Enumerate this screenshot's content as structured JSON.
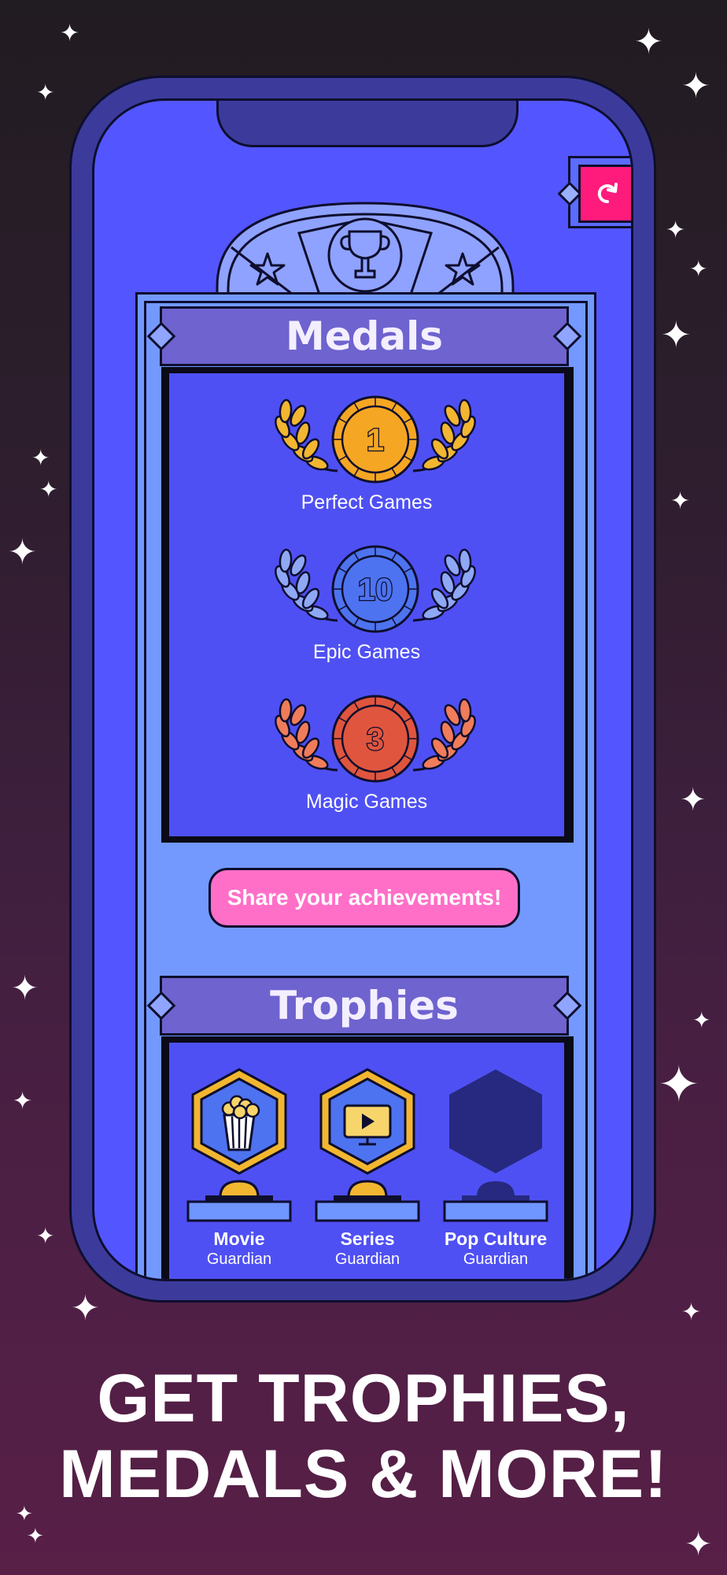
{
  "colors": {
    "background_top": "#211c21",
    "background_bottom": "#581f47",
    "phone_body": "#3c3b9c",
    "screen": "#5356ff",
    "frame": "#7399ff",
    "panel": "#4f50f3",
    "banner": "#6e63cf",
    "share_button": "#ff6fc8",
    "refresh_button": "#ff1b7c",
    "gold": "#f5a623",
    "blue": "#4d73f0",
    "red": "#e0553e"
  },
  "icons": {
    "refresh": "refresh-icon",
    "crest": "trophy-crest-icon",
    "stars": "star-icon"
  },
  "medals": {
    "title": "Medals",
    "items": [
      {
        "count": "1",
        "label": "Perfect Games",
        "color": "#f5a623",
        "leaf": "#f2b630"
      },
      {
        "count": "10",
        "label": "Epic Games",
        "color": "#4d73f0",
        "leaf": "#8ea8f5"
      },
      {
        "count": "3",
        "label": "Magic Games",
        "color": "#e0553e",
        "leaf": "#f07c5a"
      }
    ]
  },
  "share": {
    "label": "Share your achievements!"
  },
  "trophies": {
    "title": "Trophies",
    "items": [
      {
        "name": "Movie",
        "subtitle": "Guardian",
        "icon": "popcorn-icon",
        "unlocked": true
      },
      {
        "name": "Series",
        "subtitle": "Guardian",
        "icon": "tv-icon",
        "unlocked": true
      },
      {
        "name": "Pop Culture",
        "subtitle": "Guardian",
        "icon": "locked-trophy-icon",
        "unlocked": false
      }
    ]
  },
  "headline": {
    "line1": "GET TROPHIES,",
    "line2": "MEDALS & MORE!"
  }
}
